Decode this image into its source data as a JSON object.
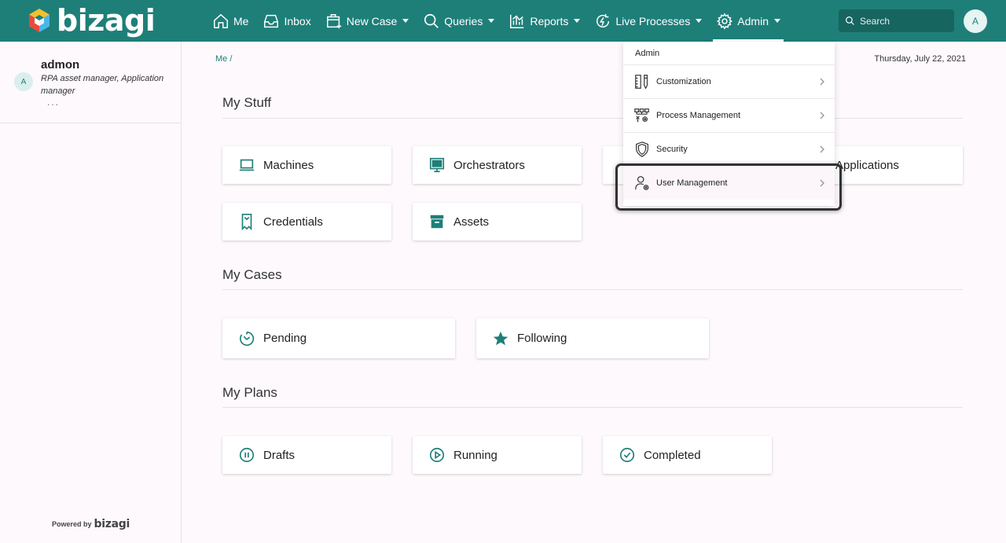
{
  "brand": {
    "logo_text": "bizagi",
    "accent": "#1e7f79"
  },
  "nav": {
    "items": [
      {
        "label": "Me",
        "icon": "home-icon"
      },
      {
        "label": "Inbox",
        "icon": "inbox-icon"
      },
      {
        "label": "New Case",
        "icon": "new-case-icon"
      },
      {
        "label": "Queries",
        "icon": "search-icon"
      },
      {
        "label": "Reports",
        "icon": "chart-icon"
      },
      {
        "label": "Live Processes",
        "icon": "live-process-icon"
      },
      {
        "label": "Admin",
        "icon": "gear-icon"
      }
    ],
    "search_placeholder": "Search",
    "avatar_initial": "A"
  },
  "sidebar": {
    "avatar_initial": "A",
    "user_name": "admon",
    "user_role": "RPA asset manager, Application manager",
    "more": "...",
    "powered_by": "Powered by",
    "powered_logo": "bizagi"
  },
  "main": {
    "breadcrumb": "Me /",
    "date": "Thursday, July 22, 2021",
    "sections": {
      "my_stuff": {
        "title": "My Stuff",
        "cards": [
          "Machines",
          "Orchestrators",
          "Applications",
          "Credentials",
          "Assets"
        ]
      },
      "my_cases": {
        "title": "My Cases",
        "cards": [
          "Pending",
          "Following"
        ]
      },
      "my_plans": {
        "title": "My Plans",
        "cards": [
          "Drafts",
          "Running",
          "Completed"
        ]
      }
    }
  },
  "admin_menu": {
    "header": "Admin",
    "items": [
      "Customization",
      "Process Management",
      "Security",
      "User Management"
    ]
  }
}
